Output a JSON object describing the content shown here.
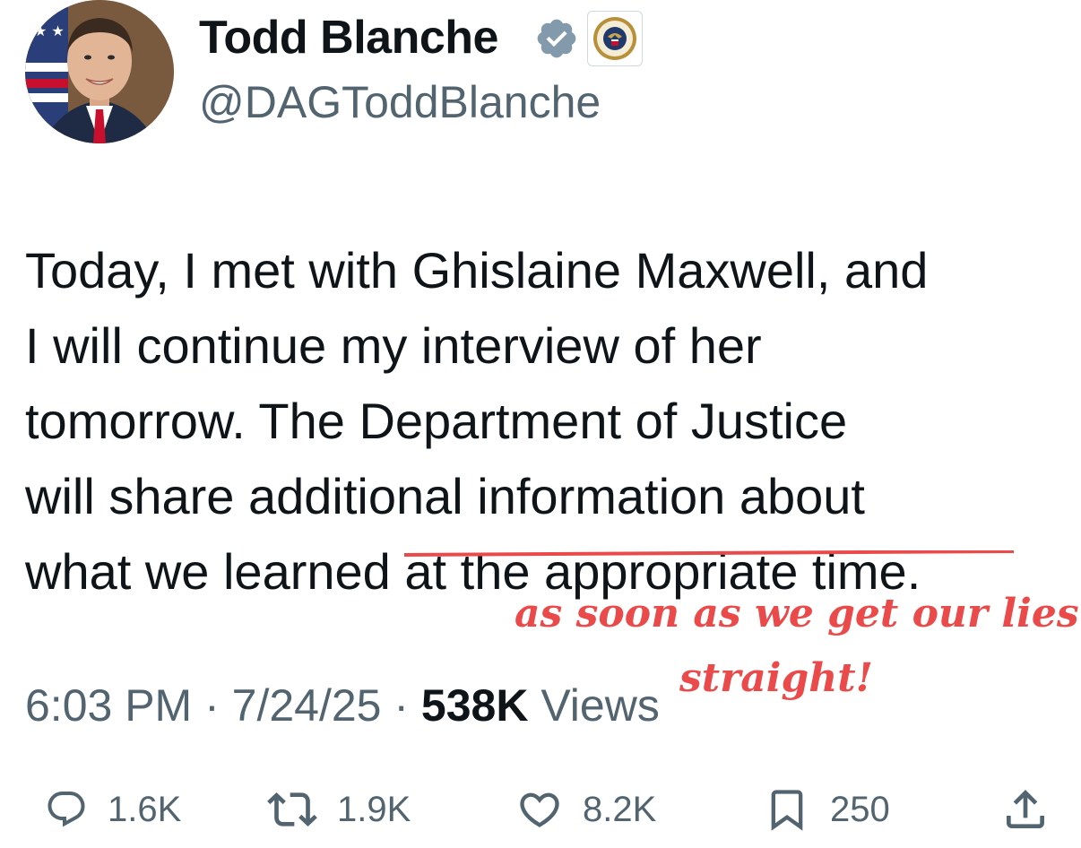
{
  "author": {
    "name": "Todd Blanche",
    "handle": "@DAGToddBlanche",
    "verified_icon": "verified-badge-icon",
    "affiliate_icon": "doj-seal-icon"
  },
  "tweet": {
    "lines": [
      "Today, I met with Ghislaine Maxwell, and",
      "I will continue my interview of her",
      "tomorrow. The Department of Justice",
      "will share additional information about"
    ],
    "last_line_prefix": "what we learned ",
    "struck_text": "at the appropriate time."
  },
  "annotation": {
    "line1": "as soon as we get our lies",
    "line2": "straight!",
    "color": "#ea4a4a"
  },
  "meta": {
    "time": "6:03 PM",
    "separator": " · ",
    "date": "7/24/25",
    "views_count": "538K",
    "views_label": " Views"
  },
  "actions": {
    "replies": "1.6K",
    "reposts": "1.9K",
    "likes": "8.2K",
    "bookmarks": "250"
  },
  "colors": {
    "text": "#0f1419",
    "secondary": "#536471",
    "verified": "#829aab"
  }
}
